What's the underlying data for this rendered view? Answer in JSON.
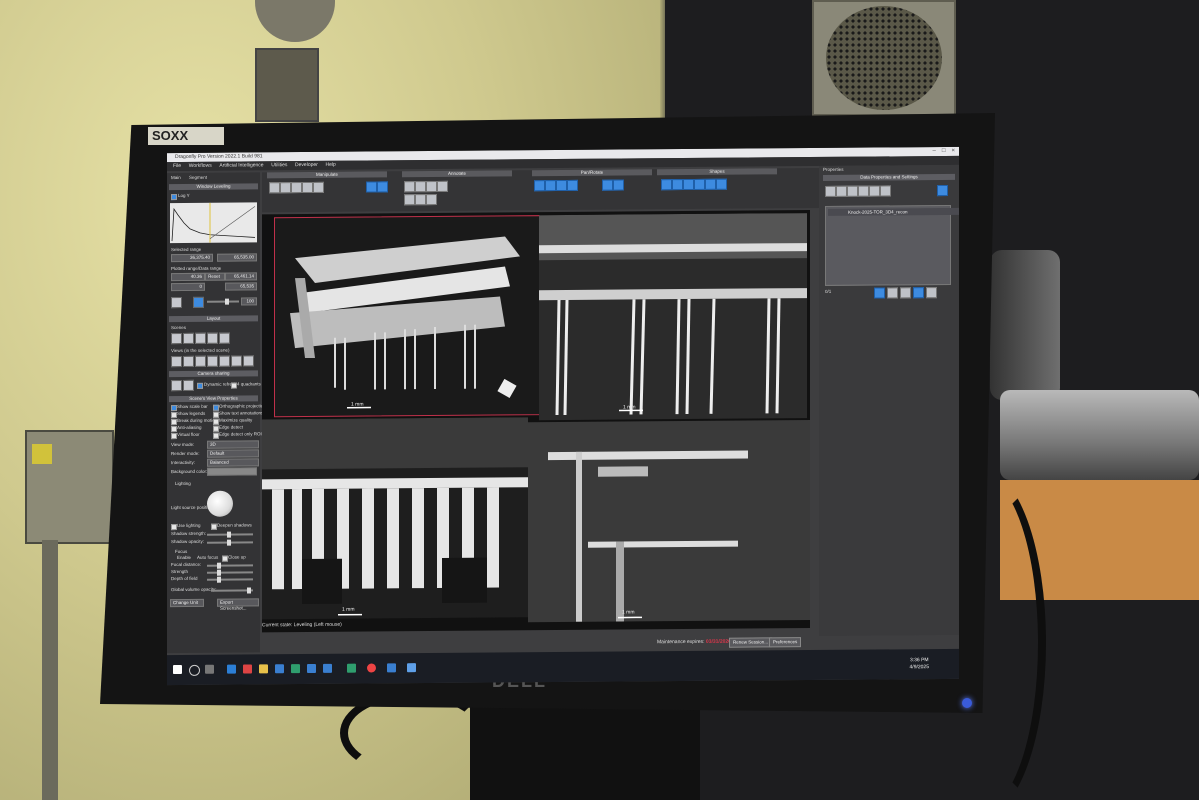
{
  "labels": {
    "asset_tag": "SOXX",
    "monitor_brand": "DELL"
  },
  "app": {
    "title": "Dragonfly Pro Version 2022.1 Build 981",
    "menu": [
      "File",
      "Workflows",
      "Artificial Intelligence",
      "Utilities",
      "Developer",
      "Help"
    ],
    "tabs": [
      "Main",
      "Segment"
    ],
    "toolbar_groups": [
      "Manipulate",
      "Annotate",
      "Pan/Rotate",
      "Shapes"
    ]
  },
  "left_panel": {
    "window_leveling": "Window Leveling",
    "log_y": "Log Y",
    "selected_range": "Selected range",
    "selected_min": "36,375.40",
    "selected_max": "65,535.00",
    "plotted_range": "Plotted range/Data range",
    "plotted_min": "40.36",
    "reset": "Reset",
    "plotted_max": "65,461.14",
    "data_min": "0",
    "data_max": "65,535",
    "opacity": "100",
    "layout": "Layout",
    "scenes": "Scenes",
    "views_in_scene": "Views (in the selected scene)",
    "camera_sharing": "Camera sharing",
    "dynamic_refresh": "Dynamic refresh",
    "four_quadrants": "4 quadrants",
    "scene_view_props": "Scene's View Properties",
    "checks": [
      {
        "label": "Show scale bar",
        "on": true
      },
      {
        "label": "Orthographic projection",
        "on": true
      },
      {
        "label": "Show legends",
        "on": false
      },
      {
        "label": "Show text annotations",
        "on": false
      },
      {
        "label": "Break during motion",
        "on": false
      },
      {
        "label": "Maximize quality",
        "on": false
      },
      {
        "label": "Anti-aliasing",
        "on": false
      },
      {
        "label": "Edge detect",
        "on": false
      },
      {
        "label": "Virtual floor",
        "on": false
      },
      {
        "label": "Edge detect only ROIs",
        "on": false
      }
    ],
    "view_mode": "View mode:",
    "view_mode_val": "3D",
    "render_mode": "Render mode:",
    "render_mode_val": "Default",
    "interactivity": "Interactivity:",
    "interactivity_val": "Balanced",
    "background_color": "Background color:",
    "lighting": "Lighting",
    "light_source": "Light source position:",
    "use_lighting": "Use lighting",
    "deepen_shadows": "Deepen shadows",
    "shadow_strength": "Shadow strength:",
    "shadow_opacity": "Shadow opacity:",
    "focus": "Focus",
    "enable": "Enable",
    "auto_focus": "Auto focus",
    "close_up": "Close up",
    "focal_distance": "Focal distance:",
    "strength": "Strength",
    "depth_of_field": "Depth of field",
    "global_opacity": "Global volume opacity:",
    "change_unit": "Change Unit",
    "export_screenshot": "Export Screenshot..."
  },
  "views": {
    "scale_tl": "1 mm",
    "scale_tr": "1 mm",
    "scale_bl": "1 mm",
    "scale_br": "1 mm",
    "current_state": "Current state: Leveling (Left mouse)"
  },
  "right_panel": {
    "title": "Properties",
    "section": "Data Properties and Settings",
    "item": "Knock-2025-TOR_3D4_recon",
    "count": "0/1"
  },
  "status_bar": {
    "maintenance_label": "Maintenance expires:",
    "maintenance_date": "03/31/2026",
    "renew": "Renew Session...",
    "preferences": "Preferences"
  },
  "taskbar": {
    "time": "3:36 PM",
    "date": "4/9/2025"
  }
}
